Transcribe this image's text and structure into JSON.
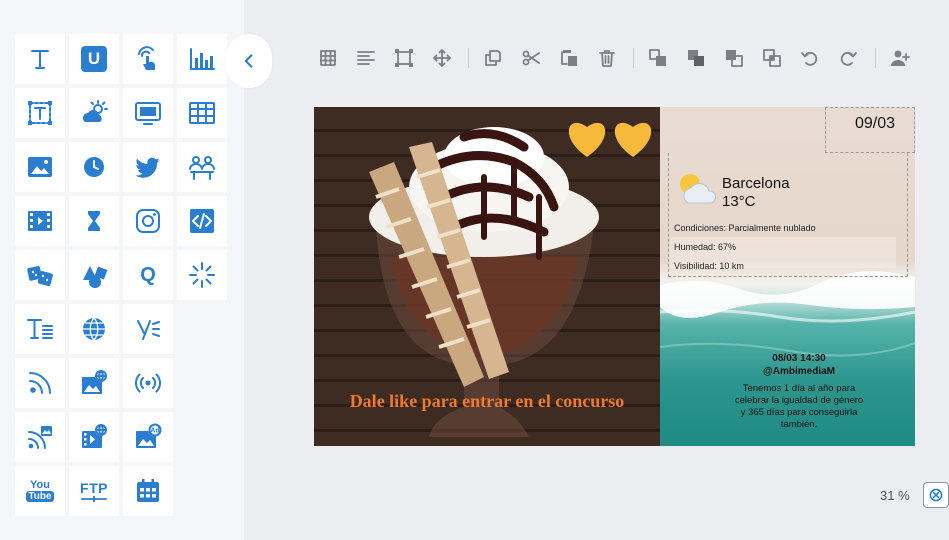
{
  "widgets": [
    {
      "name": "text-widget",
      "icon": "text-icon"
    },
    {
      "name": "u-widget",
      "icon": "u-badge-icon",
      "label": "U"
    },
    {
      "name": "touch-widget",
      "icon": "touch-pointer-icon"
    },
    {
      "name": "chart-widget",
      "icon": "bar-chart-icon"
    },
    {
      "name": "textbox-widget",
      "icon": "text-frame-icon"
    },
    {
      "name": "weather-widget",
      "icon": "weather-icon"
    },
    {
      "name": "screen-widget",
      "icon": "monitor-icon"
    },
    {
      "name": "table-widget",
      "icon": "table-icon"
    },
    {
      "name": "image-widget",
      "icon": "image-icon"
    },
    {
      "name": "clock-widget",
      "icon": "clock-icon"
    },
    {
      "name": "twitter-widget",
      "icon": "twitter-icon"
    },
    {
      "name": "queue-widget",
      "icon": "people-queue-icon"
    },
    {
      "name": "video-widget",
      "icon": "film-icon"
    },
    {
      "name": "timer-widget",
      "icon": "hourglass-icon"
    },
    {
      "name": "instagram-widget",
      "icon": "instagram-icon"
    },
    {
      "name": "html-widget",
      "icon": "code-icon"
    },
    {
      "name": "dice-widget",
      "icon": "dice-icon"
    },
    {
      "name": "shapes-widget",
      "icon": "shapes-icon"
    },
    {
      "name": "quiz-widget",
      "icon": "q-icon",
      "label": "Q"
    },
    {
      "name": "sparkle-widget",
      "icon": "burst-icon"
    },
    {
      "name": "text-list-widget",
      "icon": "text-list-icon"
    },
    {
      "name": "web-widget",
      "icon": "globe-icon"
    },
    {
      "name": "yammer-widget",
      "icon": "yammer-icon"
    },
    {
      "name": "rss-widget",
      "icon": "rss-icon"
    },
    {
      "name": "web-image-widget",
      "icon": "web-image-icon"
    },
    {
      "name": "stream-widget",
      "icon": "broadcast-icon"
    },
    {
      "name": "rss-image-widget",
      "icon": "rss-image-icon"
    },
    {
      "name": "web-video-widget",
      "icon": "web-video-icon"
    },
    {
      "name": "ad-image-widget",
      "icon": "ad-image-icon",
      "label": "Ad"
    },
    {
      "name": "youtube-widget",
      "icon": "youtube-icon",
      "label_top": "You",
      "label_bottom": "Tube"
    },
    {
      "name": "ftp-widget",
      "icon": "ftp-icon",
      "label": "FTP"
    },
    {
      "name": "calendar-widget",
      "icon": "calendar-icon"
    }
  ],
  "toolbar": [
    {
      "name": "grid-button",
      "icon": "grid-icon"
    },
    {
      "name": "align-button",
      "icon": "align-left-icon"
    },
    {
      "name": "fit-button",
      "icon": "fit-frame-icon"
    },
    {
      "name": "move-button",
      "icon": "move-arrows-icon"
    },
    {
      "name": "duplicate-button",
      "icon": "duplicate-icon"
    },
    {
      "name": "cut-button",
      "icon": "scissors-icon"
    },
    {
      "name": "paste-button",
      "icon": "paste-icon"
    },
    {
      "name": "delete-button",
      "icon": "trash-icon"
    },
    {
      "name": "bring-front-button",
      "icon": "bring-to-front-icon"
    },
    {
      "name": "send-back-button",
      "icon": "send-to-back-icon"
    },
    {
      "name": "bring-forward-button",
      "icon": "bring-forward-icon"
    },
    {
      "name": "send-backward-button",
      "icon": "send-backward-icon"
    },
    {
      "name": "undo-button",
      "icon": "undo-icon"
    },
    {
      "name": "redo-button",
      "icon": "redo-icon"
    },
    {
      "name": "add-user-button",
      "icon": "add-user-icon"
    }
  ],
  "canvas": {
    "promo_text": "Dale like para entrar en el concurso",
    "date": "09/03",
    "weather": {
      "city": "Barcelona",
      "temperature": "13°C",
      "conditions": "Condiciones: Parcialmente nublado",
      "humidity": "Humedad: 67%",
      "visibility": "Visibilidad: 10 km"
    },
    "tweet": {
      "datetime": "08/03 14:30",
      "user": "@AmbimediaM",
      "text": "Tenemos 1 día al año para celebrar la igualdad de género y 365 días para conseguirla también."
    },
    "colors": {
      "promo": "#f07a2a",
      "heart": "#f6b93b",
      "accent": "#2a7ed0"
    }
  },
  "zoom": {
    "label": "31 %",
    "icon": "reset-zoom-icon"
  }
}
